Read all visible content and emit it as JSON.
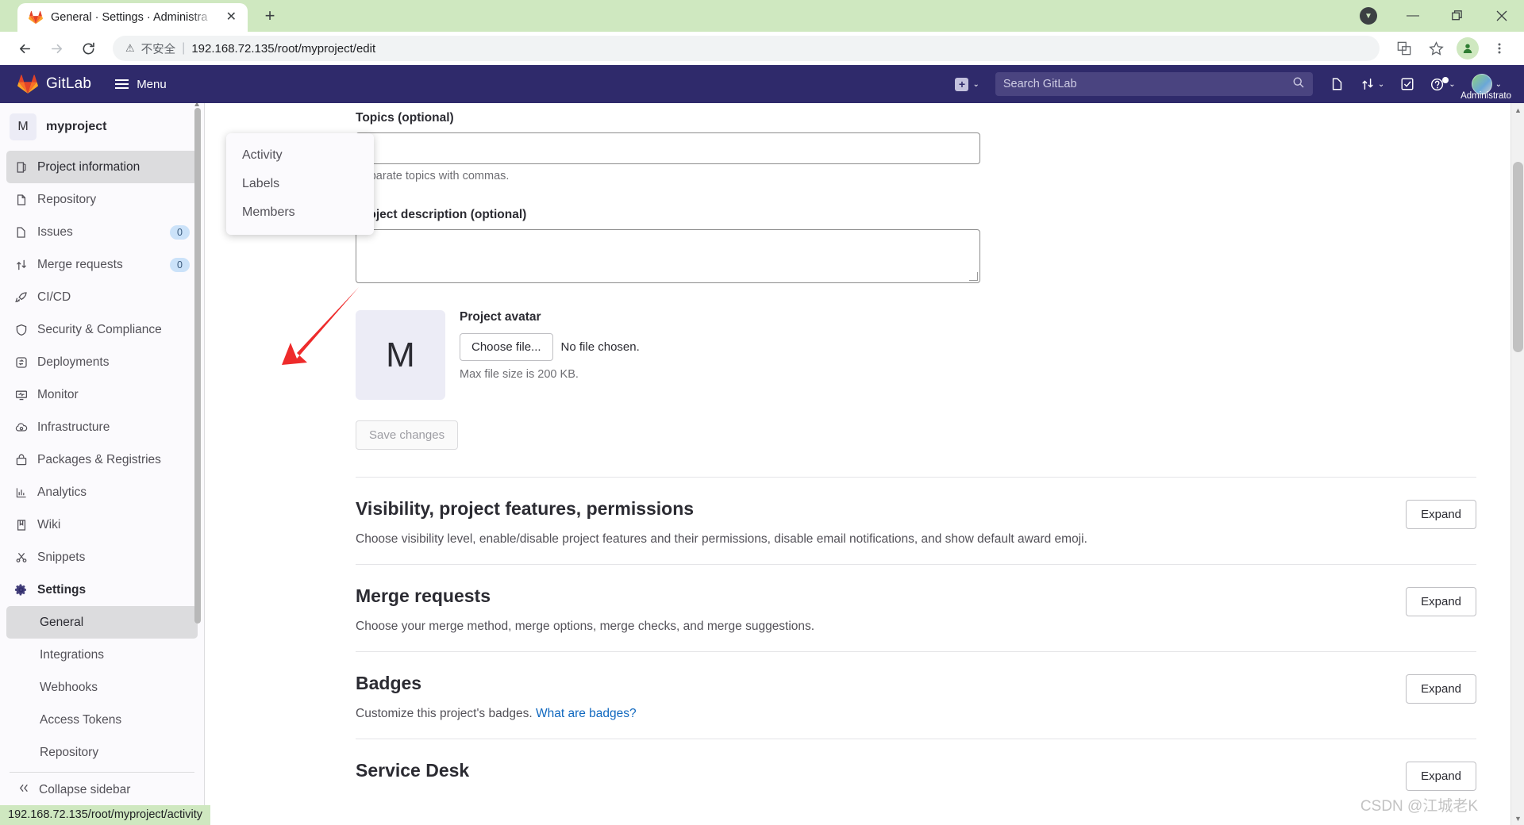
{
  "browser": {
    "tab_title": "General · Settings · Administra",
    "tab_close_icon": "close-icon",
    "new_tab_icon": "plus-icon",
    "back_icon": "arrow-left-icon",
    "forward_icon": "arrow-right-icon",
    "reload_icon": "reload-icon",
    "insecure_label": "不安全",
    "url": "192.168.72.135/root/myproject/edit",
    "translate_icon": "translate-icon",
    "bookmark_icon": "star-icon",
    "profile_icon": "account-icon",
    "menu_icon": "kebab-menu-icon",
    "minimize_label": "—",
    "maximize_label": "❐",
    "close_label": "✕",
    "update_icon": "update-available-icon"
  },
  "gitlab_header": {
    "brand": "GitLab",
    "menu_label": "Menu",
    "create_new_icon": "plus-square-icon",
    "search_placeholder": "Search GitLab",
    "search_icon": "search-icon",
    "issues_icon": "issues-icon",
    "merge_requests_icon": "merge-request-icon",
    "todos_icon": "todo-checkbox-icon",
    "help_icon": "help-question-icon",
    "user_name": "Administrato",
    "avatar_icon": "user-avatar"
  },
  "sidebar": {
    "project_initial": "M",
    "project_name": "myproject",
    "items": [
      {
        "label": "Project information",
        "icon": "project-icon",
        "badge": "",
        "active": true
      },
      {
        "label": "Repository",
        "icon": "repository-icon",
        "badge": "",
        "active": false
      },
      {
        "label": "Issues",
        "icon": "issues-icon",
        "badge": "0",
        "active": false
      },
      {
        "label": "Merge requests",
        "icon": "merge-request-icon",
        "badge": "0",
        "active": false
      },
      {
        "label": "CI/CD",
        "icon": "rocket-icon",
        "badge": "",
        "active": false
      },
      {
        "label": "Security & Compliance",
        "icon": "shield-icon",
        "badge": "",
        "active": false
      },
      {
        "label": "Deployments",
        "icon": "deployments-icon",
        "badge": "",
        "active": false
      },
      {
        "label": "Monitor",
        "icon": "monitor-icon",
        "badge": "",
        "active": false
      },
      {
        "label": "Infrastructure",
        "icon": "infrastructure-cloud-icon",
        "badge": "",
        "active": false
      },
      {
        "label": "Packages & Registries",
        "icon": "package-icon",
        "badge": "",
        "active": false
      },
      {
        "label": "Analytics",
        "icon": "chart-bar-icon",
        "badge": "",
        "active": false
      },
      {
        "label": "Wiki",
        "icon": "book-icon",
        "badge": "",
        "active": false
      },
      {
        "label": "Snippets",
        "icon": "scissors-icon",
        "badge": "",
        "active": false
      },
      {
        "label": "Settings",
        "icon": "gear-icon",
        "badge": "",
        "active": false
      }
    ],
    "settings_subitems": [
      {
        "label": "General",
        "active": true
      },
      {
        "label": "Integrations",
        "active": false
      },
      {
        "label": "Webhooks",
        "active": false
      },
      {
        "label": "Access Tokens",
        "active": false
      },
      {
        "label": "Repository",
        "active": false
      }
    ],
    "collapse_label": "Collapse sidebar",
    "collapse_icon": "chevron-double-left-icon"
  },
  "flyout": {
    "items": [
      "Activity",
      "Labels",
      "Members"
    ]
  },
  "form": {
    "topics_label": "Topics (optional)",
    "topics_value": "",
    "topics_helper": "Separate topics with commas.",
    "description_label": "Project description (optional)",
    "description_value": "",
    "avatar_initial": "M",
    "avatar_label": "Project avatar",
    "choose_file_label": "Choose file...",
    "no_file_label": "No file chosen.",
    "max_size_label": "Max file size is 200 KB.",
    "save_label": "Save changes"
  },
  "sections": [
    {
      "title": "Visibility, project features, permissions",
      "desc": "Choose visibility level, enable/disable project features and their permissions, disable email notifications, and show default award emoji.",
      "link": "",
      "button": "Expand"
    },
    {
      "title": "Merge requests",
      "desc": "Choose your merge method, merge options, merge checks, and merge suggestions.",
      "link": "",
      "button": "Expand"
    },
    {
      "title": "Badges",
      "desc": "Customize this project's badges.",
      "link": "What are badges?",
      "button": "Expand"
    },
    {
      "title": "Service Desk",
      "desc": "",
      "link": "",
      "button": "Expand"
    }
  ],
  "status_bar": {
    "link_preview": "192.168.72.135/root/myproject/activity"
  },
  "watermark": "CSDN @江城老K",
  "colors": {
    "gitlab_header": "#2f2a6b",
    "tab_strip": "#cfe8c0",
    "accent_link": "#1068bf",
    "badge_bg": "#cbe2f9",
    "arrow_red": "#ee2b2b"
  }
}
